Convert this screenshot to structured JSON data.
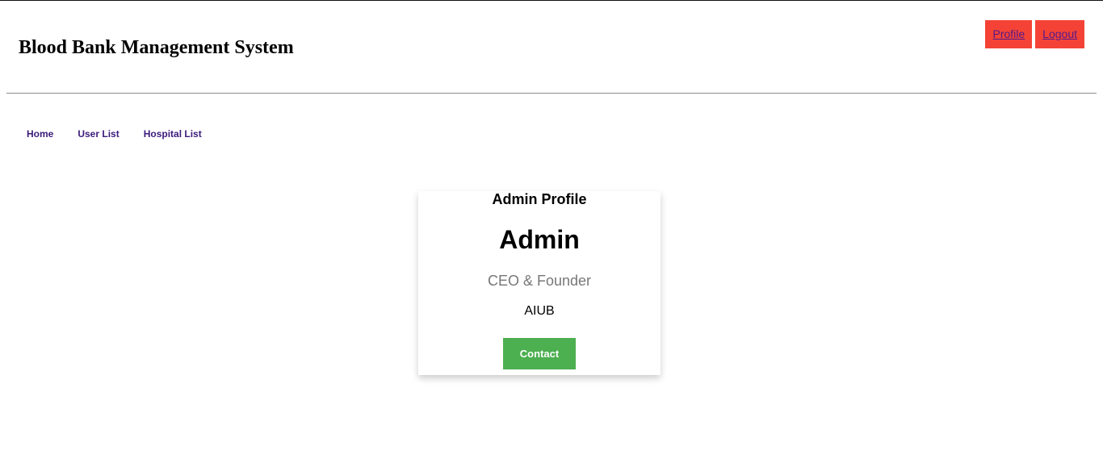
{
  "header": {
    "title": "Blood Bank Management System",
    "profile_label": "Profile",
    "logout_label": "Logout"
  },
  "nav": {
    "items": [
      {
        "label": "Home"
      },
      {
        "label": "User List"
      },
      {
        "label": "Hospital List"
      }
    ]
  },
  "card": {
    "heading": "Admin Profile",
    "name": "Admin",
    "title": "CEO & Founder",
    "organization": "AIUB",
    "contact_label": "Contact"
  },
  "colors": {
    "header_button": "#f44336",
    "contact_button": "#4caf50",
    "nav_link": "#3b1a7a",
    "subtitle": "#777777"
  }
}
